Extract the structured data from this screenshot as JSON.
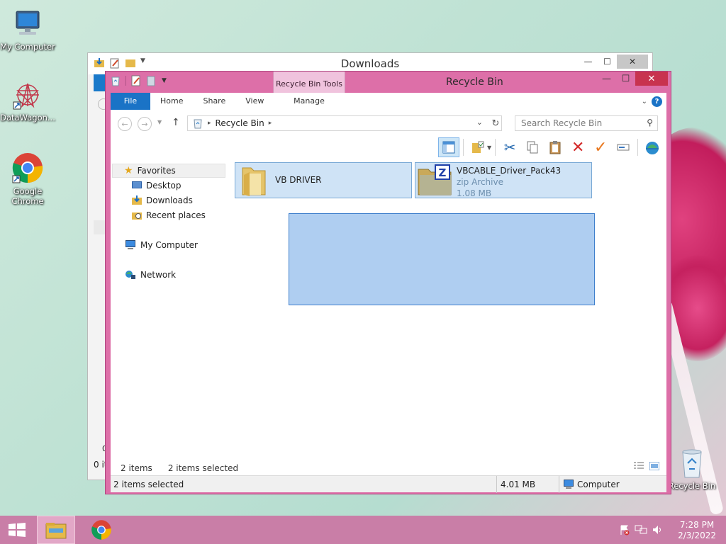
{
  "desktop": {
    "icons": [
      {
        "label": "My Computer"
      },
      {
        "label": "DataWagon..."
      },
      {
        "label": "Google Chrome"
      },
      {
        "label": "Recycle Bin"
      }
    ]
  },
  "back_window": {
    "title": "Downloads",
    "status_count": "0 it",
    "count_fragment": "0"
  },
  "window": {
    "title": "Recycle Bin",
    "context_tab": "Recycle Bin Tools",
    "ribbon_tabs": [
      "File",
      "Home",
      "Share",
      "View",
      "Manage"
    ],
    "address": {
      "crumb": "Recycle Bin"
    },
    "search_placeholder": "Search Recycle Bin",
    "nav": {
      "favorites": "Favorites",
      "items": [
        "Desktop",
        "Downloads",
        "Recent places"
      ],
      "my_computer": "My Computer",
      "network": "Network"
    },
    "files": [
      {
        "name": "VB DRIVER"
      },
      {
        "name": "VBCABLE_Driver_Pack43",
        "type": "zip Archive",
        "size": "1.08 MB"
      }
    ],
    "pane_status": {
      "count": "2 items",
      "selected": "2 items selected"
    },
    "statusbar": {
      "selected": "2 items selected",
      "size": "4.01 MB",
      "location": "Computer"
    }
  },
  "taskbar": {
    "time": "7:28 PM",
    "date": "2/3/2022"
  },
  "colors": {
    "accent": "#1a73c6",
    "window_frame": "#dd6fa8",
    "taskbar": "#c97ea7",
    "close": "#c8334f",
    "selection": "#cfe3f6"
  }
}
